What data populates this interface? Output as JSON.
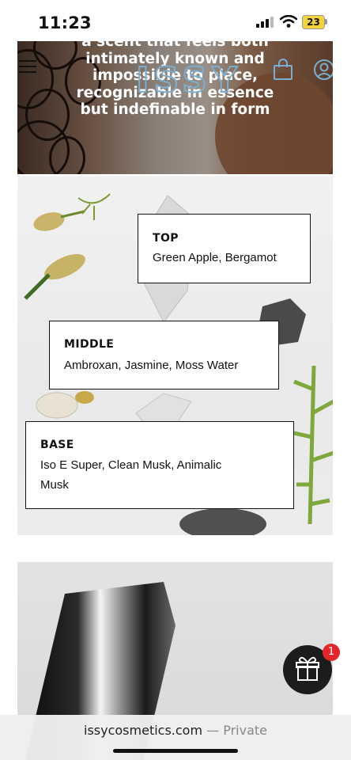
{
  "status_bar": {
    "time": "11:23",
    "battery": "23"
  },
  "hero": {
    "lines": [
      "a scent that feels both",
      "intimately known and",
      "impossible to place,",
      "recognizable in essence",
      "but indefinable in form"
    ]
  },
  "header": {
    "logo": "ISSY"
  },
  "notes": {
    "top": {
      "title": "TOP",
      "text": "Green Apple, Bergamot"
    },
    "middle": {
      "title": "MIDDLE",
      "text": "Ambroxan, Jasmine, Moss Water"
    },
    "base": {
      "title": "BASE",
      "text_line1": "Iso E Super, Clean Musk, Animalic",
      "text_line2": "Musk"
    }
  },
  "gift": {
    "badge": "1"
  },
  "browser": {
    "host": "issycosmetics.com",
    "separator": " — ",
    "mode": "Private"
  },
  "colors": {
    "badge": "#e3262b",
    "gift_button": "#1c1c1c",
    "logo": "#7aaed0"
  }
}
